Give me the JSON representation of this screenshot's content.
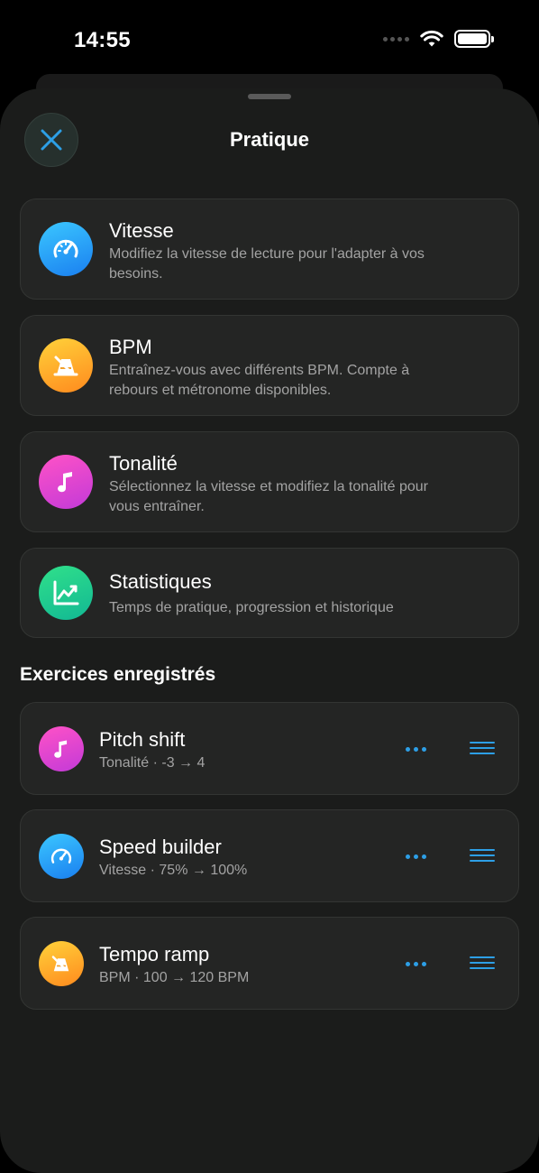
{
  "status": {
    "time": "14:55"
  },
  "sheet": {
    "title": "Pratique"
  },
  "features": [
    {
      "title": "Vitesse",
      "desc": "Modifiez la vitesse de lecture pour l'adapter à vos besoins.",
      "icon": "speedometer-icon"
    },
    {
      "title": "BPM",
      "desc": "Entraînez-vous avec différents BPM. Compte à rebours et métronome disponibles.",
      "icon": "metronome-icon"
    },
    {
      "title": "Tonalité",
      "desc": "Sélectionnez la vitesse et modifiez la tonalité pour vous entraîner.",
      "icon": "music-note-icon"
    },
    {
      "title": "Statistiques",
      "desc": "Temps de pratique, progression et historique",
      "icon": "chart-line-icon"
    }
  ],
  "saved": {
    "title": "Exercices enregistrés",
    "items": [
      {
        "title": "Pitch shift",
        "sub": "Tonalité · -3 → 4",
        "icon": "music-note-icon"
      },
      {
        "title": "Speed builder",
        "sub": "Vitesse · 75% → 100%",
        "icon": "speedometer-icon"
      },
      {
        "title": "Tempo ramp",
        "sub": "BPM · 100 → 120 BPM",
        "icon": "metronome-icon"
      }
    ]
  },
  "colors": {
    "accent": "#2d9fe6",
    "sheet_bg": "#1b1c1b",
    "card_bg": "#242524"
  }
}
